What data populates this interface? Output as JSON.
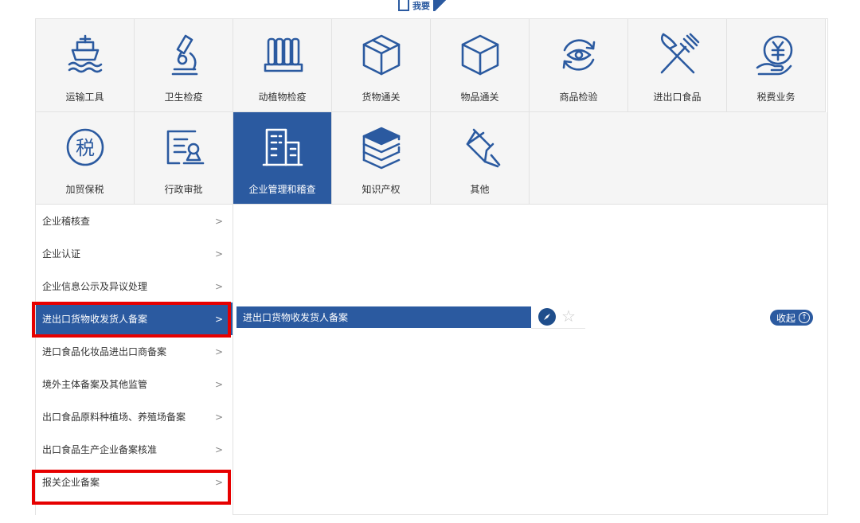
{
  "brand": {
    "text": "我要"
  },
  "tiles_row1": [
    {
      "label": "运输工具",
      "icon": "ship-icon"
    },
    {
      "label": "卫生检疫",
      "icon": "microscope-icon"
    },
    {
      "label": "动植物检疫",
      "icon": "columns-icon"
    },
    {
      "label": "货物通关",
      "icon": "package-icon"
    },
    {
      "label": "物品通关",
      "icon": "box-icon"
    },
    {
      "label": "商品检验",
      "icon": "eye-rotate-icon"
    },
    {
      "label": "进出口食品",
      "icon": "fork-knife-icon"
    },
    {
      "label": "税费业务",
      "icon": "yen-hand-icon"
    }
  ],
  "tiles_row2": [
    {
      "label": "加贸保税",
      "icon": "tax-circle-icon"
    },
    {
      "label": "行政审批",
      "icon": "approval-icon"
    },
    {
      "label": "企业管理和稽查",
      "icon": "building-icon",
      "active": true
    },
    {
      "label": "知识产权",
      "icon": "books-icon"
    },
    {
      "label": "其他",
      "icon": "pin-icon"
    }
  ],
  "menu": {
    "items": [
      "企业稽核查",
      "企业认证",
      "企业信息公示及异议处理",
      "进出口货物收发货人备案",
      "进口食品化妆品进出口商备案",
      "境外主体备案及其他监管",
      "出口食品原料种植场、养殖场备案",
      "出口食品生产企业备案核准",
      "报关企业备案"
    ],
    "active_index": 3,
    "chevron": ">"
  },
  "content": {
    "sub_item": "进出口货物收发货人备案",
    "collapse_label": "收起",
    "compass_icon": "compass-icon",
    "star_icon": "star-icon"
  },
  "colors": {
    "accent": "#2b5aa0",
    "highlight": "#e60000"
  }
}
